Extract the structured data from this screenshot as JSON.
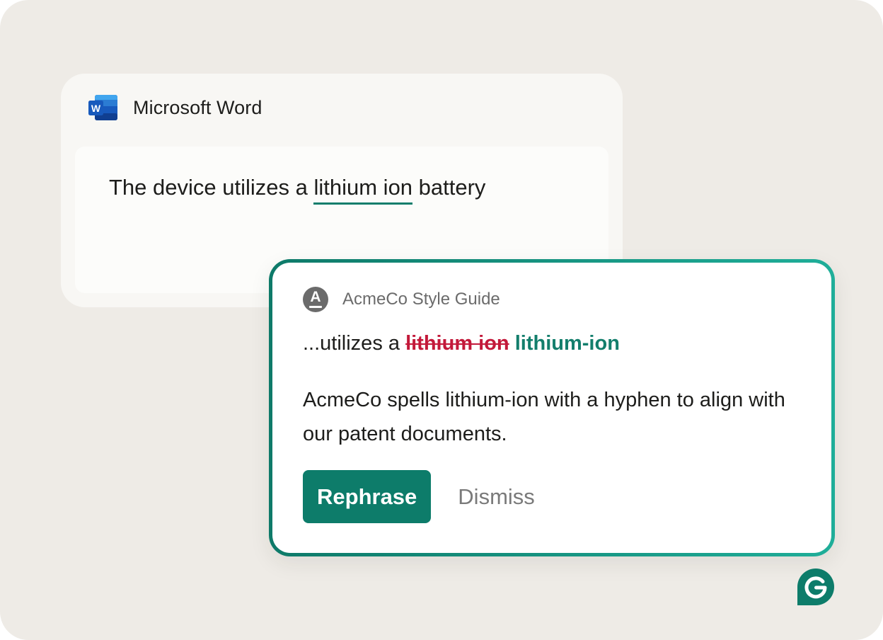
{
  "word_window": {
    "app_icon": "microsoft-word-icon",
    "app_title": "Microsoft Word",
    "document": {
      "text_before": "The device utilizes a ",
      "flagged_text": "lithium ion",
      "text_after": " battery"
    }
  },
  "suggestion_card": {
    "style_guide_icon": "style-guide-a-icon",
    "style_guide_letter": "A",
    "style_guide_name": "AcmeCo Style Guide",
    "context_prefix": "...utilizes a ",
    "removed_text": "lithium ion",
    "replacement_text": "lithium-ion",
    "explanation": "AcmeCo spells lithium-ion with a hyphen to align with our patent documents.",
    "primary_action": "Rephrase",
    "secondary_action": "Dismiss"
  },
  "assistant_logo": "grammarly-g-icon",
  "colors": {
    "background": "#eeebe6",
    "accent": "#0d7c6a",
    "accent_light": "#1fae99",
    "removed": "#c3193a",
    "word_blue": "#185abd"
  }
}
